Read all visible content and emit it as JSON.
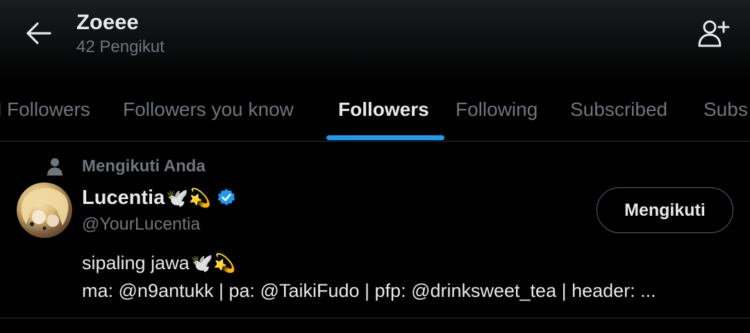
{
  "header": {
    "title": "Zoeee",
    "subtitle": "42 Pengikut"
  },
  "tabs": [
    {
      "label": "l Followers"
    },
    {
      "label": "Followers you know"
    },
    {
      "label": "Followers",
      "active": true
    },
    {
      "label": "Following"
    },
    {
      "label": "Subscribed"
    },
    {
      "label": "Subs"
    }
  ],
  "follower": {
    "follows_you_label": "Mengikuti Anda",
    "name": "Lucentia",
    "name_emojis": "🕊️💫",
    "handle": "@YourLucentia",
    "follow_button_label": "Mengikuti",
    "bio_line1_text": "sipaling jawa",
    "bio_line1_emojis": "🕊️💫",
    "bio_line2": "ma: @n9antukk | pa: @TaikiFudo | pfp: @drinksweet_tea | header: ..."
  },
  "colors": {
    "accent": "#1d9bf0",
    "muted": "#71767b",
    "text": "#e7e9ea",
    "divider": "#2f3336"
  },
  "icons": {
    "back": "arrow-left-icon",
    "add_user": "person-plus-icon",
    "follows_you": "person-icon",
    "verified": "verified-badge-icon"
  }
}
